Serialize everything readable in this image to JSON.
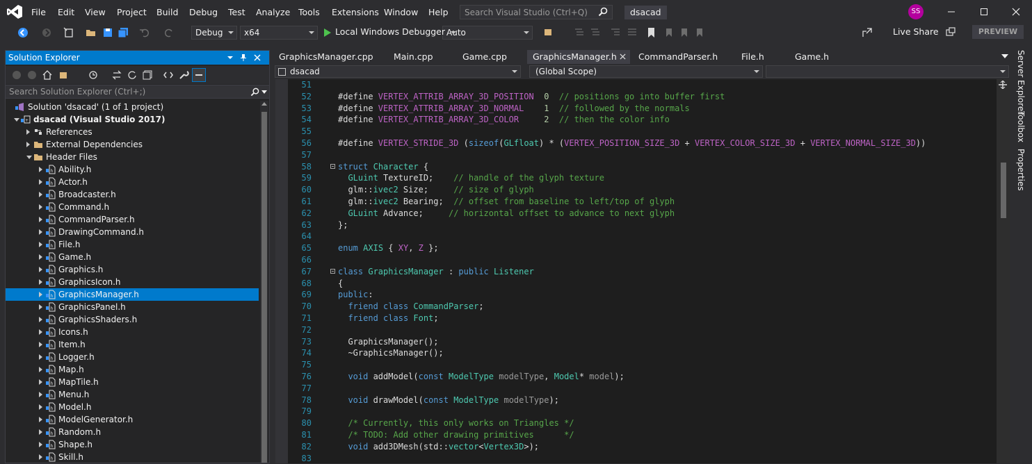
{
  "menu": [
    "File",
    "Edit",
    "View",
    "Project",
    "Build",
    "Debug",
    "Test",
    "Analyze",
    "Tools",
    "Extensions",
    "Window",
    "Help"
  ],
  "search": {
    "placeholder": "Search Visual Studio (Ctrl+Q)"
  },
  "solution_name": "dsacad",
  "user_initials": "SS",
  "toolbar": {
    "configuration": "Debug",
    "platform": "x64",
    "run_label": "Local Windows Debugger",
    "auto_combo": "Auto",
    "live_share": "Live Share",
    "preview": "PREVIEW"
  },
  "solution_explorer": {
    "title": "Solution Explorer",
    "search_placeholder": "Search Solution Explorer (Ctrl+;)",
    "items": [
      {
        "label": "Solution 'dsacad' (1 of 1 project)",
        "depth": 0,
        "expand": "none",
        "icon": "solution-icon"
      },
      {
        "label": "dsacad (Visual Studio 2017)",
        "depth": 1,
        "expand": "open",
        "icon": "project-icon",
        "bold": true
      },
      {
        "label": "References",
        "depth": 2,
        "expand": "closed",
        "icon": "references-icon"
      },
      {
        "label": "External Dependencies",
        "depth": 2,
        "expand": "closed",
        "icon": "folder-icon"
      },
      {
        "label": "Header Files",
        "depth": 2,
        "expand": "open",
        "icon": "folder-open-icon"
      },
      {
        "label": "Ability.h",
        "depth": 3,
        "expand": "closed",
        "icon": "header-file-icon"
      },
      {
        "label": "Actor.h",
        "depth": 3,
        "expand": "closed",
        "icon": "header-file-icon"
      },
      {
        "label": "Broadcaster.h",
        "depth": 3,
        "expand": "closed",
        "icon": "header-file-icon"
      },
      {
        "label": "Command.h",
        "depth": 3,
        "expand": "closed",
        "icon": "header-file-icon"
      },
      {
        "label": "CommandParser.h",
        "depth": 3,
        "expand": "closed",
        "icon": "header-file-icon"
      },
      {
        "label": "DrawingCommand.h",
        "depth": 3,
        "expand": "closed",
        "icon": "header-file-icon"
      },
      {
        "label": "File.h",
        "depth": 3,
        "expand": "closed",
        "icon": "header-file-icon"
      },
      {
        "label": "Game.h",
        "depth": 3,
        "expand": "closed",
        "icon": "header-file-icon"
      },
      {
        "label": "Graphics.h",
        "depth": 3,
        "expand": "closed",
        "icon": "header-file-icon"
      },
      {
        "label": "GraphicsIcon.h",
        "depth": 3,
        "expand": "closed",
        "icon": "header-file-icon"
      },
      {
        "label": "GraphicsManager.h",
        "depth": 3,
        "expand": "closed",
        "icon": "header-file-icon",
        "selected": true
      },
      {
        "label": "GraphicsPanel.h",
        "depth": 3,
        "expand": "closed",
        "icon": "header-file-icon"
      },
      {
        "label": "GraphicsShaders.h",
        "depth": 3,
        "expand": "closed",
        "icon": "header-file-icon"
      },
      {
        "label": "Icons.h",
        "depth": 3,
        "expand": "closed",
        "icon": "header-file-icon"
      },
      {
        "label": "Item.h",
        "depth": 3,
        "expand": "closed",
        "icon": "header-file-icon"
      },
      {
        "label": "Logger.h",
        "depth": 3,
        "expand": "closed",
        "icon": "header-file-icon"
      },
      {
        "label": "Map.h",
        "depth": 3,
        "expand": "closed",
        "icon": "header-file-icon"
      },
      {
        "label": "MapTile.h",
        "depth": 3,
        "expand": "closed",
        "icon": "header-file-icon"
      },
      {
        "label": "Menu.h",
        "depth": 3,
        "expand": "closed",
        "icon": "header-file-icon"
      },
      {
        "label": "Model.h",
        "depth": 3,
        "expand": "closed",
        "icon": "header-file-icon"
      },
      {
        "label": "ModelGenerator.h",
        "depth": 3,
        "expand": "closed",
        "icon": "header-file-icon"
      },
      {
        "label": "Random.h",
        "depth": 3,
        "expand": "closed",
        "icon": "header-file-icon"
      },
      {
        "label": "Shape.h",
        "depth": 3,
        "expand": "closed",
        "icon": "header-file-icon"
      },
      {
        "label": "Skill.h",
        "depth": 3,
        "expand": "closed",
        "icon": "header-file-icon"
      }
    ]
  },
  "tabs": [
    {
      "label": "GraphicsManager.cpp",
      "active": false
    },
    {
      "label": "Main.cpp",
      "active": false
    },
    {
      "label": "Game.cpp",
      "active": false
    },
    {
      "label": "GraphicsManager.h",
      "active": true
    },
    {
      "label": "CommandParser.h",
      "active": false
    },
    {
      "label": "File.h",
      "active": false
    },
    {
      "label": "Game.h",
      "active": false
    }
  ],
  "nav": {
    "project": "dsacad",
    "scope": "(Global Scope)",
    "member": ""
  },
  "side_tabs": [
    "Server Explorer",
    "Toolbox",
    "Properties"
  ],
  "code": [
    {
      "n": "51",
      "fold": false,
      "t": []
    },
    {
      "n": "52",
      "fold": false,
      "t": [
        [
          "",
          "#define "
        ],
        [
          "macro",
          "VERTEX_ATTRIB_ARRAY_3D_POSITION"
        ],
        [
          "",
          "  "
        ],
        [
          "num",
          "0"
        ],
        [
          "",
          "  "
        ],
        [
          "cmt",
          "// positions go into buffer first"
        ]
      ]
    },
    {
      "n": "53",
      "fold": false,
      "t": [
        [
          "",
          "#define "
        ],
        [
          "macro",
          "VERTEX_ATTRIB_ARRAY_3D_NORMAL"
        ],
        [
          "",
          "    "
        ],
        [
          "num",
          "1"
        ],
        [
          "",
          "  "
        ],
        [
          "cmt",
          "// followed by the normals"
        ]
      ]
    },
    {
      "n": "54",
      "fold": false,
      "t": [
        [
          "",
          "#define "
        ],
        [
          "macro",
          "VERTEX_ATTRIB_ARRAY_3D_COLOR"
        ],
        [
          "",
          "     "
        ],
        [
          "num",
          "2"
        ],
        [
          "",
          "  "
        ],
        [
          "cmt",
          "// then the color info"
        ]
      ]
    },
    {
      "n": "55",
      "fold": false,
      "t": []
    },
    {
      "n": "56",
      "fold": false,
      "t": [
        [
          "",
          "#define "
        ],
        [
          "macro",
          "VERTEX_STRIDE_3D"
        ],
        [
          "",
          " ("
        ],
        [
          "kw",
          "sizeof"
        ],
        [
          "",
          "("
        ],
        [
          "type",
          "GLfloat"
        ],
        [
          "",
          ") * ("
        ],
        [
          "macro",
          "VERTEX_POSITION_SIZE_3D"
        ],
        [
          "",
          " + "
        ],
        [
          "macro",
          "VERTEX_COLOR_SIZE_3D"
        ],
        [
          "",
          " + "
        ],
        [
          "macro",
          "VERTEX_NORMAL_SIZE_3D"
        ],
        [
          "",
          "))"
        ]
      ]
    },
    {
      "n": "57",
      "fold": false,
      "t": []
    },
    {
      "n": "58",
      "fold": true,
      "t": [
        [
          "kw",
          "struct"
        ],
        [
          "",
          " "
        ],
        [
          "type",
          "Character"
        ],
        [
          "",
          " {"
        ]
      ]
    },
    {
      "n": "59",
      "fold": false,
      "t": [
        [
          "",
          "  "
        ],
        [
          "type",
          "GLuint"
        ],
        [
          "",
          " TextureID;    "
        ],
        [
          "cmt",
          "// handle of the glyph texture"
        ]
      ]
    },
    {
      "n": "60",
      "fold": false,
      "t": [
        [
          "",
          "  glm::"
        ],
        [
          "type",
          "ivec2"
        ],
        [
          "",
          " Size;     "
        ],
        [
          "cmt",
          "// size of glyph"
        ]
      ]
    },
    {
      "n": "61",
      "fold": false,
      "t": [
        [
          "",
          "  glm::"
        ],
        [
          "type",
          "ivec2"
        ],
        [
          "",
          " Bearing;  "
        ],
        [
          "cmt",
          "// offset from baseline to left/top of glyph"
        ]
      ]
    },
    {
      "n": "62",
      "fold": false,
      "t": [
        [
          "",
          "  "
        ],
        [
          "type",
          "GLuint"
        ],
        [
          "",
          " Advance;     "
        ],
        [
          "cmt",
          "// horizontal offset to advance to next glyph"
        ]
      ]
    },
    {
      "n": "63",
      "fold": false,
      "t": [
        [
          "",
          "};"
        ]
      ]
    },
    {
      "n": "64",
      "fold": false,
      "t": []
    },
    {
      "n": "65",
      "fold": false,
      "t": [
        [
          "kw",
          "enum"
        ],
        [
          "",
          " "
        ],
        [
          "type",
          "AXIS"
        ],
        [
          "",
          " { "
        ],
        [
          "macro",
          "X"
        ],
        [
          ", "
        ],
        [
          "macro",
          "Y"
        ],
        [
          "",
          ", "
        ],
        [
          "macro",
          "Z"
        ],
        [
          "",
          " };"
        ]
      ]
    },
    {
      "n": "66",
      "fold": false,
      "t": []
    },
    {
      "n": "67",
      "fold": true,
      "t": [
        [
          "kw",
          "class"
        ],
        [
          "",
          " "
        ],
        [
          "type",
          "GraphicsManager"
        ],
        [
          "",
          " : "
        ],
        [
          "kw",
          "public"
        ],
        [
          "",
          " "
        ],
        [
          "type",
          "Listener"
        ]
      ]
    },
    {
      "n": "68",
      "fold": false,
      "t": [
        [
          "",
          "{"
        ]
      ]
    },
    {
      "n": "69",
      "fold": false,
      "t": [
        [
          "kw",
          "public"
        ],
        [
          "",
          ":"
        ]
      ]
    },
    {
      "n": "70",
      "fold": false,
      "t": [
        [
          "",
          "  "
        ],
        [
          "kw",
          "friend"
        ],
        [
          "",
          " "
        ],
        [
          "kw",
          "class"
        ],
        [
          "",
          " "
        ],
        [
          "type",
          "CommandParser"
        ],
        [
          "",
          ";"
        ]
      ]
    },
    {
      "n": "71",
      "fold": false,
      "t": [
        [
          "",
          "  "
        ],
        [
          "kw",
          "friend"
        ],
        [
          "",
          " "
        ],
        [
          "kw",
          "class"
        ],
        [
          "",
          " "
        ],
        [
          "type",
          "Font"
        ],
        [
          "",
          ";"
        ]
      ]
    },
    {
      "n": "72",
      "fold": false,
      "t": []
    },
    {
      "n": "73",
      "fold": false,
      "t": [
        [
          "",
          "  GraphicsManager();"
        ]
      ]
    },
    {
      "n": "74",
      "fold": false,
      "t": [
        [
          "",
          "  ~GraphicsManager();"
        ]
      ]
    },
    {
      "n": "75",
      "fold": false,
      "t": []
    },
    {
      "n": "76",
      "fold": false,
      "t": [
        [
          "",
          "  "
        ],
        [
          "kw",
          "void"
        ],
        [
          "",
          " addModel("
        ],
        [
          "kw",
          "const"
        ],
        [
          "",
          " "
        ],
        [
          "type",
          "ModelType"
        ],
        [
          "",
          " "
        ],
        [
          "param",
          "modelType"
        ],
        [
          "",
          ", "
        ],
        [
          "type",
          "Model"
        ],
        [
          "",
          "* "
        ],
        [
          "param",
          "model"
        ],
        [
          "",
          ");"
        ]
      ]
    },
    {
      "n": "77",
      "fold": false,
      "t": []
    },
    {
      "n": "78",
      "fold": false,
      "t": [
        [
          "",
          "  "
        ],
        [
          "kw",
          "void"
        ],
        [
          "",
          " drawModel("
        ],
        [
          "kw",
          "const"
        ],
        [
          "",
          " "
        ],
        [
          "type",
          "ModelType"
        ],
        [
          "",
          " "
        ],
        [
          "param",
          "modelType"
        ],
        [
          "",
          ");"
        ]
      ]
    },
    {
      "n": "79",
      "fold": false,
      "t": []
    },
    {
      "n": "80",
      "fold": false,
      "t": [
        [
          "",
          "  "
        ],
        [
          "cmt",
          "/* Currently, this only works on Triangles */"
        ]
      ]
    },
    {
      "n": "81",
      "fold": false,
      "t": [
        [
          "",
          "  "
        ],
        [
          "cmt",
          "/* TODO: Add other drawing primitives      */"
        ]
      ]
    },
    {
      "n": "82",
      "fold": false,
      "t": [
        [
          "",
          "  "
        ],
        [
          "kw",
          "void"
        ],
        [
          "",
          " add3DMesh(std::"
        ],
        [
          "type",
          "vector"
        ],
        [
          "",
          "<"
        ],
        [
          "type",
          "Vertex3D"
        ],
        [
          "",
          ">);"
        ]
      ]
    },
    {
      "n": "83",
      "fold": false,
      "t": []
    }
  ]
}
